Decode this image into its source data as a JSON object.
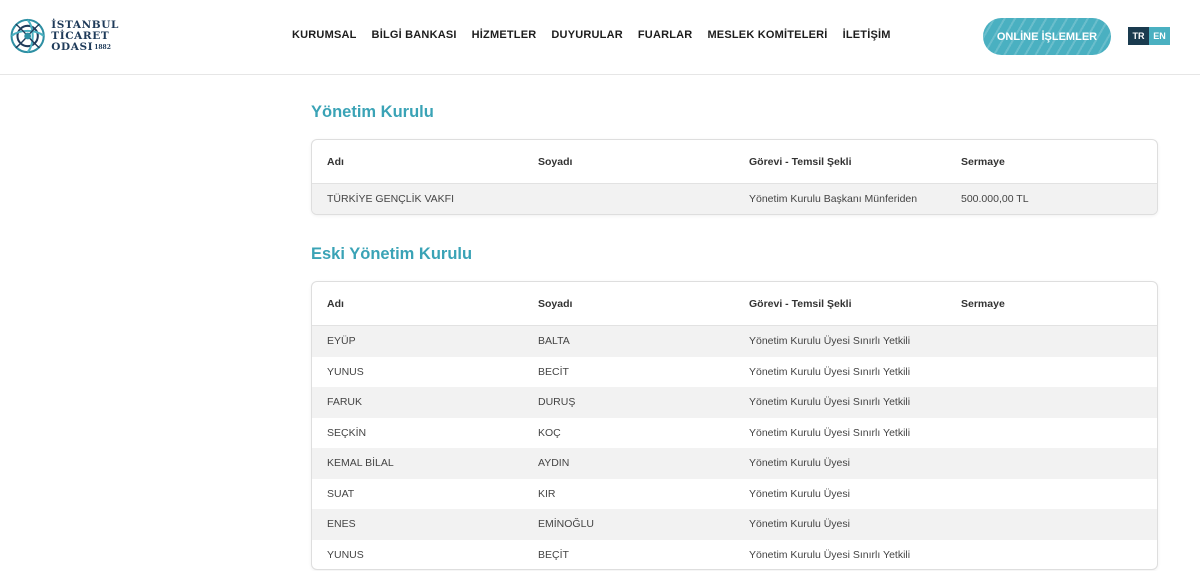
{
  "logo": {
    "line1": "İSTANBUL",
    "line2": "TİCARET",
    "line3": "ODASI",
    "year": "1882",
    "icon": "ito-logo-mark"
  },
  "nav": {
    "items": [
      "KURUMSAL",
      "BİLGİ BANKASI",
      "HİZMETLER",
      "DUYURULAR",
      "FUARLAR",
      "MESLEK KOMİTELERİ",
      "İLETİŞİM"
    ]
  },
  "online_button": "ONLİNE İŞLEMLER",
  "lang": {
    "tr": "TR",
    "en": "EN"
  },
  "colors": {
    "accent": "#3aa3b6",
    "button": "#4ab0c1",
    "dark": "#1a3b4f"
  },
  "board": {
    "title": "Yönetim Kurulu",
    "headers": [
      "Adı",
      "Soyadı",
      "Görevi - Temsil Şekli",
      "Sermaye"
    ],
    "rows": [
      [
        "TÜRKİYE GENÇLİK VAKFI",
        "",
        "Yönetim Kurulu Başkanı Münferiden",
        "500.000,00 TL"
      ]
    ]
  },
  "old_board": {
    "title": "Eski Yönetim Kurulu",
    "headers": [
      "Adı",
      "Soyadı",
      "Görevi - Temsil Şekli",
      "Sermaye"
    ],
    "rows": [
      [
        "EYÜP",
        "BALTA",
        "Yönetim Kurulu Üyesi Sınırlı Yetkili",
        ""
      ],
      [
        "YUNUS",
        "BECİT",
        "Yönetim Kurulu Üyesi Sınırlı Yetkili",
        ""
      ],
      [
        "FARUK",
        "DURUŞ",
        "Yönetim Kurulu Üyesi Sınırlı Yetkili",
        ""
      ],
      [
        "SEÇKİN",
        "KOÇ",
        "Yönetim Kurulu Üyesi Sınırlı Yetkili",
        ""
      ],
      [
        "KEMAL BİLAL",
        "AYDIN",
        "Yönetim Kurulu Üyesi",
        ""
      ],
      [
        "SUAT",
        "KIR",
        "Yönetim Kurulu Üyesi",
        ""
      ],
      [
        "ENES",
        "EMİNOĞLU",
        "Yönetim Kurulu Üyesi",
        ""
      ],
      [
        "YUNUS",
        "BEÇİT",
        "Yönetim Kurulu Üyesi Sınırlı Yetkili",
        ""
      ]
    ]
  }
}
